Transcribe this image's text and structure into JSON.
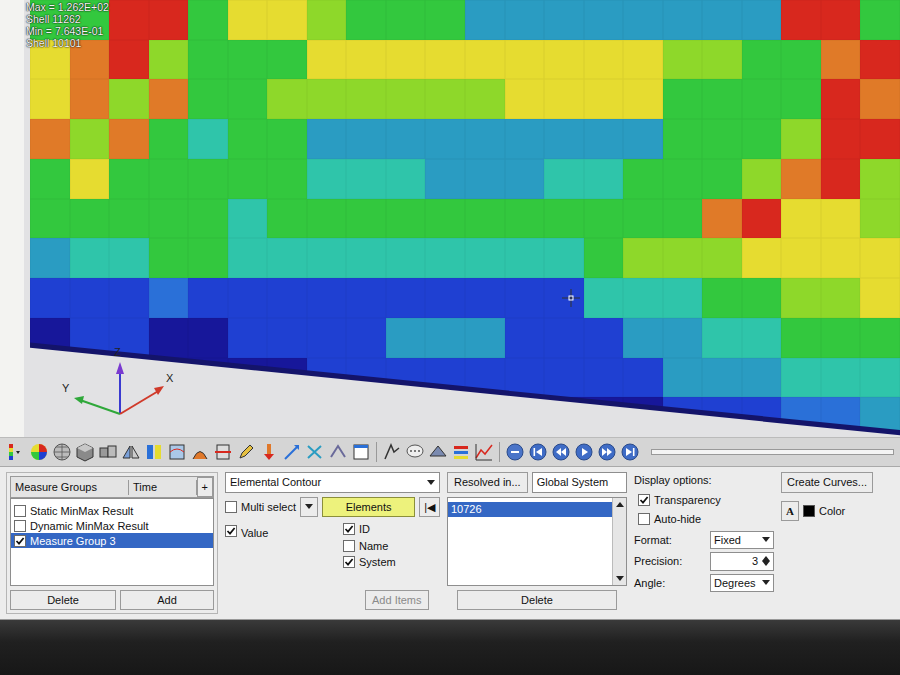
{
  "plot": {
    "annotations": [
      "Max = 1.262E+02",
      "Shell 11262",
      "Min = 7.643E-01",
      "Shell 10101"
    ],
    "triad": [
      "Z",
      "Y",
      "X"
    ],
    "cells": [
      [
        5,
        5,
        9,
        9,
        5,
        7,
        7,
        6,
        5,
        5,
        5,
        3,
        3,
        3,
        3,
        3,
        3,
        3,
        3,
        9,
        9,
        5
      ],
      [
        7,
        8,
        9,
        6,
        5,
        5,
        5,
        7,
        7,
        7,
        7,
        7,
        7,
        7,
        7,
        7,
        6,
        6,
        5,
        5,
        8,
        9
      ],
      [
        7,
        8,
        6,
        8,
        5,
        5,
        6,
        6,
        6,
        6,
        6,
        6,
        7,
        7,
        7,
        7,
        5,
        5,
        5,
        5,
        9,
        8
      ],
      [
        8,
        6,
        8,
        5,
        4,
        5,
        5,
        3,
        3,
        3,
        3,
        3,
        3,
        3,
        3,
        3,
        5,
        5,
        5,
        6,
        9,
        9
      ],
      [
        5,
        7,
        5,
        5,
        5,
        5,
        5,
        4,
        4,
        4,
        3,
        3,
        3,
        4,
        4,
        5,
        5,
        5,
        6,
        8,
        9,
        6
      ],
      [
        5,
        5,
        5,
        5,
        5,
        4,
        5,
        5,
        5,
        5,
        5,
        5,
        5,
        5,
        5,
        5,
        5,
        8,
        9,
        7,
        7,
        6
      ],
      [
        3,
        4,
        4,
        5,
        5,
        4,
        4,
        4,
        4,
        4,
        4,
        4,
        4,
        4,
        5,
        6,
        6,
        6,
        7,
        7,
        7,
        7
      ],
      [
        1,
        1,
        1,
        2,
        1,
        1,
        1,
        1,
        1,
        1,
        1,
        1,
        1,
        1,
        4,
        4,
        4,
        5,
        5,
        6,
        6,
        7
      ],
      [
        0,
        1,
        1,
        0,
        0,
        1,
        1,
        1,
        1,
        3,
        3,
        3,
        1,
        1,
        1,
        3,
        3,
        4,
        4,
        5,
        5,
        5
      ],
      [
        0,
        0,
        0,
        0,
        0,
        0,
        0,
        1,
        1,
        1,
        1,
        1,
        1,
        1,
        1,
        1,
        3,
        3,
        3,
        4,
        4,
        4
      ],
      [
        0,
        0,
        0,
        0,
        0,
        0,
        0,
        0,
        0,
        0,
        0,
        0,
        0,
        0,
        0,
        0,
        1,
        1,
        1,
        2,
        2,
        3
      ]
    ]
  },
  "measure_groups": {
    "columns": [
      "Measure Groups",
      "Time"
    ],
    "add_column": "+",
    "items": [
      {
        "label": "Static MinMax Result",
        "checked": false,
        "selected": false
      },
      {
        "label": "Dynamic MinMax Result",
        "checked": false,
        "selected": false
      },
      {
        "label": "Measure Group 3",
        "checked": true,
        "selected": true
      }
    ],
    "buttons": [
      "Delete",
      "Add"
    ]
  },
  "measure": {
    "type": "Elemental Contour",
    "multi_select": {
      "label": "Multi select",
      "checked": false
    },
    "entity": "Elements",
    "first_button": "|◀",
    "value": {
      "label": "Value",
      "checked": true
    },
    "labels": [
      {
        "label": "ID",
        "checked": true
      },
      {
        "label": "Name",
        "checked": false
      },
      {
        "label": "System",
        "checked": true
      }
    ],
    "add_items": {
      "label": "Add Items",
      "disabled": true
    }
  },
  "resolved": {
    "button": "Resolved in...",
    "system": "Global System",
    "items": [
      {
        "label": "10726",
        "selected": true
      }
    ],
    "delete": "Delete"
  },
  "display": {
    "title": "Display options:",
    "transparency": {
      "label": "Transparency",
      "checked": true
    },
    "auto_hide": {
      "label": "Auto-hide",
      "checked": false
    },
    "format": {
      "label": "Format:",
      "value": "Fixed"
    },
    "precision": {
      "label": "Precision:",
      "value": "3"
    },
    "angle": {
      "label": "Angle:",
      "value": "Degrees"
    }
  },
  "curves": {
    "button": "Create Curves...",
    "font_button": "A",
    "color_label": "Color",
    "color": "#000000"
  }
}
